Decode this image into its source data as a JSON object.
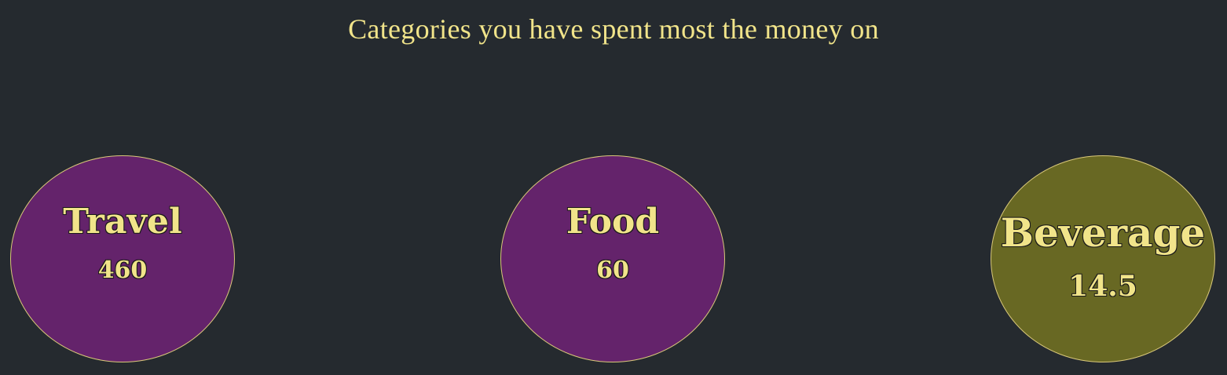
{
  "title": "Categories you have spent most the money on",
  "colors": {
    "background": "#252a2f",
    "text": "#f1e48a",
    "border": "#d9c879"
  },
  "categories": [
    {
      "label": "Travel",
      "value": "460",
      "fill": "#64236b"
    },
    {
      "label": "Food",
      "value": "60",
      "fill": "#64236b"
    },
    {
      "label": "Beverage",
      "value": "14.5",
      "fill": "#686823"
    }
  ]
}
